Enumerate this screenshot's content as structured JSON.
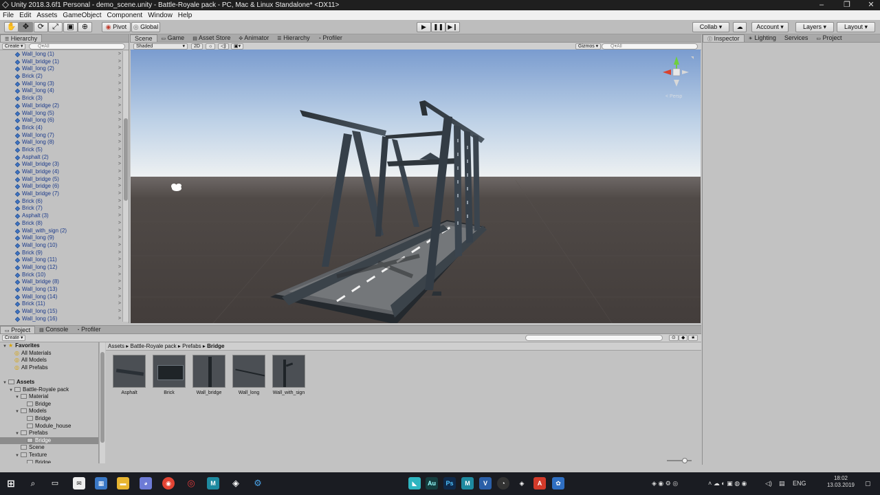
{
  "window": {
    "title": "Unity 2018.3.6f1 Personal - demo_scene.unity - Battle-Royale pack - PC, Mac & Linux Standalone* <DX11>",
    "controls": [
      "–",
      "❐",
      "✕"
    ]
  },
  "menu": [
    "File",
    "Edit",
    "Assets",
    "GameObject",
    "Component",
    "Window",
    "Help"
  ],
  "toolbar": {
    "pivot": "Pivot",
    "global": "Global",
    "collab": "Collab ▾",
    "account": "Account",
    "layers": "Layers",
    "layout": "Layout"
  },
  "hierarchy": {
    "tab": "Hierarchy",
    "create": "Create ▾",
    "search_placeholder": "Q▾All",
    "items": [
      "Wall_long (1)",
      "Wall_bridge (1)",
      "Wall_long (2)",
      "Brick (2)",
      "Wall_long (3)",
      "Wall_long (4)",
      "Brick (3)",
      "Wall_bridge (2)",
      "Wall_long (5)",
      "Wall_long (6)",
      "Brick (4)",
      "Wall_long (7)",
      "Wall_long (8)",
      "Brick (5)",
      "Asphalt (2)",
      "Wall_bridge (3)",
      "Wall_bridge (4)",
      "Wall_bridge (5)",
      "Wall_bridge (6)",
      "Wall_bridge (7)",
      "Brick (6)",
      "Brick (7)",
      "Asphalt (3)",
      "Brick (8)",
      "Wall_with_sign (2)",
      "Wall_long (9)",
      "Wall_long (10)",
      "Brick (9)",
      "Wall_long (11)",
      "Wall_long (12)",
      "Brick (10)",
      "Wall_bridge (8)",
      "Wall_long (13)",
      "Wall_long (14)",
      "Brick (11)",
      "Wall_long (15)",
      "Wall_long (16)"
    ]
  },
  "center_tabs": [
    "Scene",
    "Game",
    "Asset Store",
    "Animator",
    "Hierarchy",
    "Profiler"
  ],
  "scene_bar": {
    "shaded": "Shaded",
    "mode2d": "2D",
    "gizmos": "Gizmos ▾",
    "search_placeholder": "Q▾All",
    "persp": "< Persp"
  },
  "right_tabs": [
    "Inspector",
    "Lighting",
    "Services",
    "Project"
  ],
  "bottom_tabs": [
    "Project",
    "Console",
    "Profiler"
  ],
  "project": {
    "create": "Create ▾",
    "breadcrumb": [
      "Assets",
      "Battle-Royale pack",
      "Prefabs",
      "Bridge"
    ],
    "tree": [
      {
        "label": "Favorites",
        "depth": 0,
        "kind": "header-fav"
      },
      {
        "label": "All Materials",
        "depth": 1,
        "kind": "fav"
      },
      {
        "label": "All Models",
        "depth": 1,
        "kind": "fav"
      },
      {
        "label": "All Prefabs",
        "depth": 1,
        "kind": "fav"
      },
      {
        "label": "",
        "depth": 0,
        "kind": "spacer"
      },
      {
        "label": "Assets",
        "depth": 0,
        "kind": "header"
      },
      {
        "label": "Battle-Royale pack",
        "depth": 1,
        "kind": "open"
      },
      {
        "label": "Material",
        "depth": 2,
        "kind": "open"
      },
      {
        "label": "Bridge",
        "depth": 3,
        "kind": "folder"
      },
      {
        "label": "Models",
        "depth": 2,
        "kind": "open"
      },
      {
        "label": "Bridge",
        "depth": 3,
        "kind": "folder"
      },
      {
        "label": "Module_house",
        "depth": 3,
        "kind": "folder"
      },
      {
        "label": "Prefabs",
        "depth": 2,
        "kind": "open"
      },
      {
        "label": "Bridge",
        "depth": 3,
        "kind": "selected"
      },
      {
        "label": "Scene",
        "depth": 2,
        "kind": "folder"
      },
      {
        "label": "Texture",
        "depth": 2,
        "kind": "open"
      },
      {
        "label": "Bridge",
        "depth": 3,
        "kind": "folder"
      }
    ],
    "assets": [
      "Asphalt",
      "Brick",
      "Wall_bridge",
      "Wall_long",
      "Wall_with_sign"
    ]
  },
  "taskbar": {
    "lang": "ENG",
    "time": "18:02",
    "date": "13.03.2019",
    "apps": [
      "Au",
      "Ps",
      "M",
      "V"
    ]
  },
  "colors": {
    "hier_text": "#1b3a8a",
    "sky_top": "#7c9fd1",
    "sky_horizon": "#e6ecef",
    "ground": "#4c4644"
  }
}
